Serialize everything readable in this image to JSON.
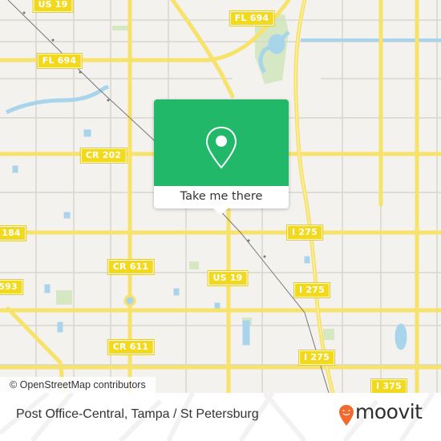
{
  "map": {
    "colors": {
      "land": "#f3f2ee",
      "road_major": "#f7e26b",
      "road_minor": "#d9d6cf",
      "water": "#a8d4ec",
      "park": "#d6e8c3",
      "rail": "#777777",
      "shield": "#f2d91e"
    },
    "road_labels": [
      {
        "id": "us19-top",
        "text": "US 19"
      },
      {
        "id": "fl694-top",
        "text": "FL 694"
      },
      {
        "id": "fl694-left",
        "text": "FL 694"
      },
      {
        "id": "cr202",
        "text": "CR 202"
      },
      {
        "id": "us19-mid",
        "text": "US 19"
      },
      {
        "id": "fl184",
        "text": "184"
      },
      {
        "id": "i275-a",
        "text": "I 275"
      },
      {
        "id": "cr611-a",
        "text": "CR 611"
      },
      {
        "id": "us19-low",
        "text": "US 19"
      },
      {
        "id": "fl593",
        "text": "593"
      },
      {
        "id": "i275-b",
        "text": "I 275"
      },
      {
        "id": "cr611-b",
        "text": "CR 611"
      },
      {
        "id": "i275-c",
        "text": "I 275"
      },
      {
        "id": "i375",
        "text": "I 375"
      }
    ],
    "attribution": "© OpenStreetMap contributors"
  },
  "popup": {
    "icon": "map-pin-icon",
    "button_label": "Take me there",
    "color": "#21b86a"
  },
  "footer": {
    "place_title": "Post Office-Central, Tampa / St Petersburg",
    "brand_name": "moovit",
    "brand_icon": "moovit-pin-logo-icon",
    "brand_color": "#f26a2e"
  }
}
